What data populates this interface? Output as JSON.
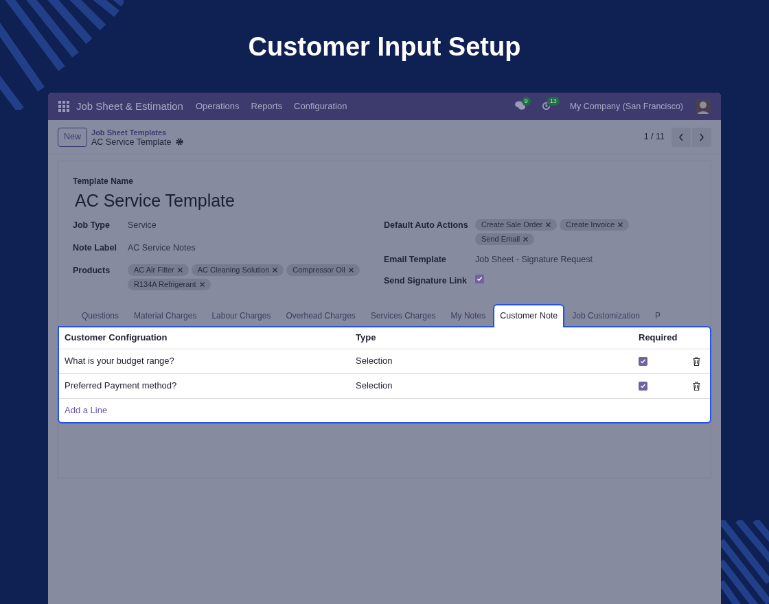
{
  "title": "Customer Input Setup",
  "navbar": {
    "app_name": "Job Sheet & Estimation",
    "menus": [
      "Operations",
      "Reports",
      "Configuration"
    ],
    "messages_count": "9",
    "activities_count": "13",
    "company": "My Company (San Francisco)"
  },
  "control_panel": {
    "new_button": "New",
    "breadcrumb": "Job Sheet Templates",
    "record": "AC Service Template",
    "pager": "1 / 11"
  },
  "form": {
    "name_label": "Template Name",
    "name": "AC Service Template",
    "left_fields": [
      {
        "label": "Job Type",
        "kind": "text",
        "value": "Service"
      },
      {
        "label": "Note Label",
        "kind": "text",
        "value": "AC Service Notes"
      },
      {
        "label": "Products",
        "kind": "tags",
        "tags": [
          "AC Air Filter",
          "AC Cleaning Solution",
          "Compressor Oil",
          "R134A Refrigerant"
        ]
      }
    ],
    "right_fields": [
      {
        "label": "Default Auto Actions",
        "kind": "tags",
        "tags": [
          "Create Sale Order",
          "Create Invoice",
          "Send Email"
        ]
      },
      {
        "label": "Email Template",
        "kind": "text",
        "value": "Job Sheet - Signature Request"
      },
      {
        "label": "Send Signature Link",
        "kind": "checkbox",
        "checked": true
      }
    ]
  },
  "tabs": [
    {
      "label": "Questions",
      "selected": false
    },
    {
      "label": "Material Charges",
      "selected": false
    },
    {
      "label": "Labour Charges",
      "selected": false
    },
    {
      "label": "Overhead Charges",
      "selected": false
    },
    {
      "label": "Services Charges",
      "selected": false
    },
    {
      "label": "My Notes",
      "selected": false
    },
    {
      "label": "Customer Note",
      "selected": true
    },
    {
      "label": "Job Customization",
      "selected": false
    },
    {
      "label": "P",
      "selected": false
    }
  ],
  "table": {
    "columns": [
      "Customer Configruation",
      "Type",
      "Required"
    ],
    "rows": [
      {
        "question": "What is your budget range?",
        "type": "Selection",
        "required": true
      },
      {
        "question": "Preferred Payment method?",
        "type": "Selection",
        "required": true
      }
    ],
    "add_line": "Add a Line"
  }
}
